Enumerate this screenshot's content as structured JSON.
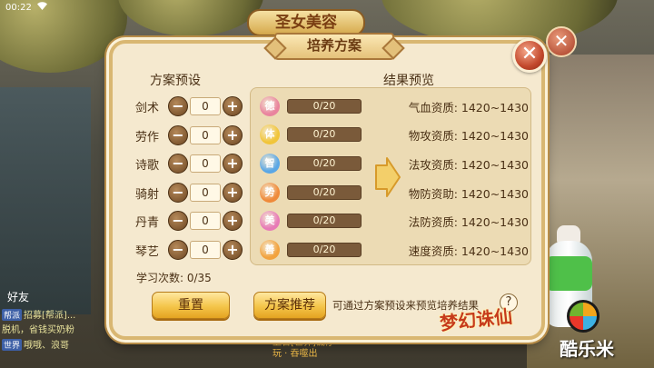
{
  "status_bar": {
    "time": "00:22",
    "wifi_icon": "wifi-icon"
  },
  "background": {
    "title_plaque": "圣女美容",
    "chat_title": "好友",
    "chat_lines": [
      {
        "tag": "帮派",
        "text": "招募[帮派]..."
      },
      {
        "tag": "",
        "text": "脱机，省钱买奶粉"
      },
      {
        "tag": "世界",
        "text": "哦哦、浪哥"
      }
    ],
    "bottom_text_1": "上官[世界]诚仔",
    "bottom_text_2": "玩 · 吞噬出"
  },
  "dialog": {
    "title": "培养方案",
    "close_label": "✕",
    "left_title": "方案预设",
    "right_title": "结果预览",
    "skills": [
      {
        "name": "剑术",
        "value": "0"
      },
      {
        "name": "劳作",
        "value": "0"
      },
      {
        "name": "诗歌",
        "value": "0"
      },
      {
        "name": "骑射",
        "value": "0"
      },
      {
        "name": "丹青",
        "value": "0"
      },
      {
        "name": "琴艺",
        "value": "0"
      }
    ],
    "minus": "−",
    "plus": "+",
    "study_count": "学习次数: 0/35",
    "attributes": [
      {
        "icon": "德",
        "color": "#e9849e",
        "progress": "0/20",
        "fraction": 0,
        "label": "气血资质: 1420~1430"
      },
      {
        "icon": "体",
        "color": "#f1c53a",
        "progress": "0/20",
        "fraction": 0,
        "label": "物攻资质: 1420~1430"
      },
      {
        "icon": "智",
        "color": "#5aa7e6",
        "progress": "0/20",
        "fraction": 0,
        "label": "法攻资质: 1420~1430"
      },
      {
        "icon": "势",
        "color": "#ef8a3a",
        "progress": "0/20",
        "fraction": 0,
        "label": "物防资助: 1420~1430"
      },
      {
        "icon": "美",
        "color": "#e77bb7",
        "progress": "0/20",
        "fraction": 0,
        "label": "法防资质: 1420~1430"
      },
      {
        "icon": "善",
        "color": "#f2a23e",
        "progress": "0/20",
        "fraction": 0,
        "label": "速度资质: 1420~1430"
      }
    ],
    "reset_button": "重置",
    "plan_button": "方案推荐",
    "hint": "可通过方案预设来预览培养结果",
    "help_label": "?"
  },
  "watermark": {
    "game_logo": "梦幻诛仙",
    "site_name": "酷乐米"
  }
}
